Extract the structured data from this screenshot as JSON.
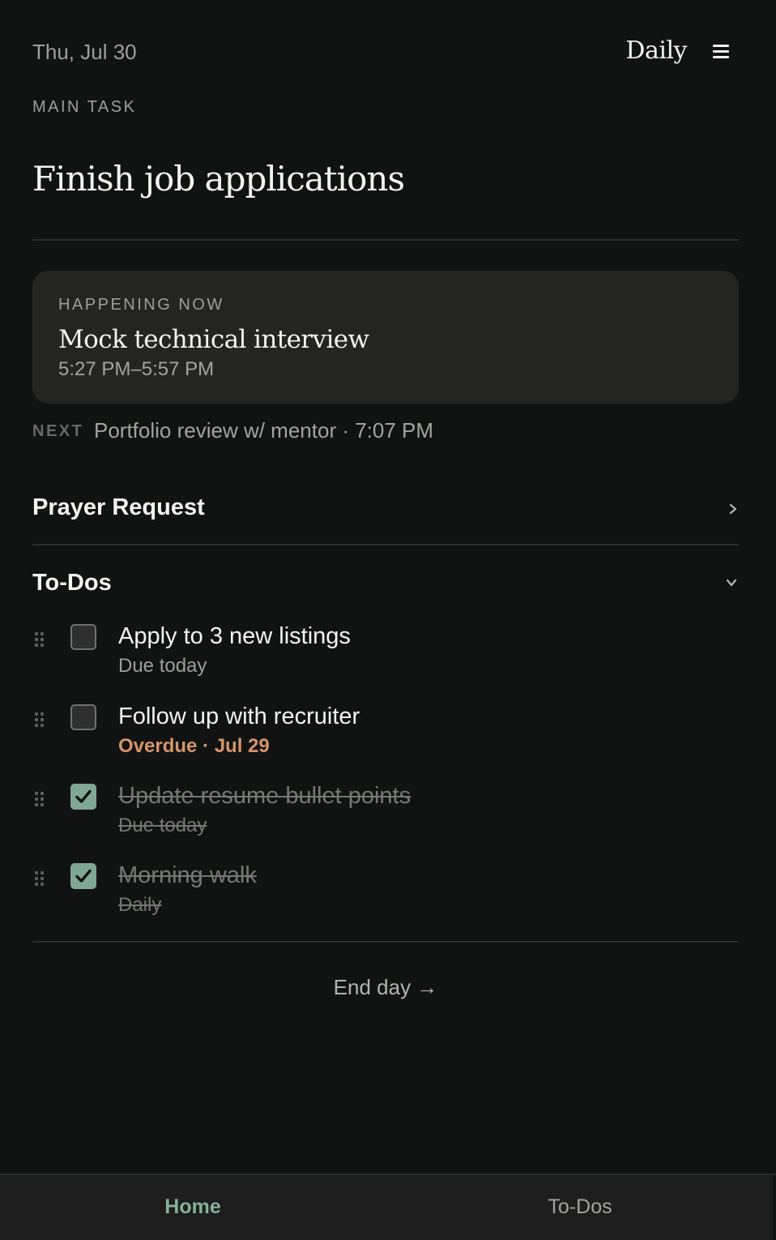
{
  "header": {
    "date": "Thu, Jul 30",
    "app_title": "Daily"
  },
  "main_task": {
    "label": "MAIN TASK",
    "title": "Finish job applications"
  },
  "happening_now": {
    "label": "HAPPENING NOW",
    "title": "Mock technical interview",
    "time": "5:27 PM–5:57 PM"
  },
  "next_event": {
    "label": "NEXT",
    "text": "Portfolio review w/ mentor · 7:07 PM"
  },
  "sections": {
    "prayer": {
      "title": "Prayer Request",
      "state": "collapsed"
    },
    "todos": {
      "title": "To-Dos",
      "state": "expanded"
    }
  },
  "todos": [
    {
      "title": "Apply to 3 new listings",
      "subtitle": "Due today",
      "done": false
    },
    {
      "title": "Follow up with recruiter",
      "subtitle": "Overdue · Jul 29",
      "done": false,
      "overdue": true
    },
    {
      "title": "Update resume bullet points",
      "subtitle": "Due today",
      "done": true
    },
    {
      "title": "Morning walk",
      "subtitle": "Daily",
      "done": true
    }
  ],
  "end_day": {
    "label": "End day →"
  },
  "tabs": [
    {
      "label": "Home",
      "active": true
    },
    {
      "label": "To-Dos",
      "active": false
    }
  ],
  "colors": {
    "background": "#111313",
    "card": "#242523",
    "accent_green": "#86b19a",
    "checkbox_checked": "#7fa793",
    "overdue": "#d6946b"
  },
  "icons": {
    "menu": "hamburger-menu-icon",
    "prayer_chevron": "chevron-right-icon",
    "todos_chevron": "chevron-down-icon",
    "drag": "drag-handle-icon",
    "check": "checkmark-icon"
  }
}
